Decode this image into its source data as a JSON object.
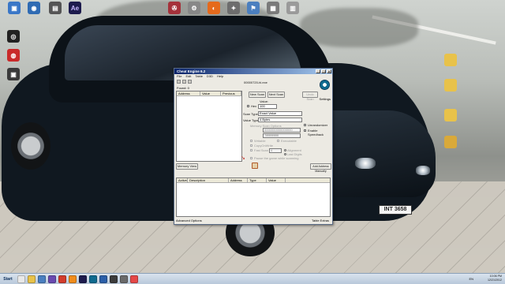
{
  "window": {
    "title": "Cheat Engine 6.2",
    "menu": [
      "File",
      "Edit",
      "Table",
      "D3D",
      "Help"
    ],
    "process": "00000720-hl.exe",
    "found": "Found: 0",
    "settings": "Settings",
    "results_columns": [
      "Address",
      "Value",
      "Previous"
    ],
    "buttons": {
      "new_scan": "New Scan",
      "next_scan": "Next Scan",
      "undo_scan": "Undo Scan",
      "memory_view": "Memory View",
      "add_address": "Add Address Manually"
    },
    "value_label": "Value:",
    "hex_label": "Hex",
    "value_input": "100",
    "scan_type_label": "Scan Type",
    "scan_type": "Exact Value",
    "value_type_label": "Value Type",
    "value_type": "4 Bytes",
    "memory_scan_options": "Memory Scan Options",
    "start_addr": "0000000000000000",
    "stop_addr": "7fffffffffffffff",
    "writable": "Writable",
    "executable": "Executable",
    "copy_on_write": "CopyOnWrite",
    "fast_scan": "Fast Scan",
    "alignment": "Alignment",
    "last_digits": "Last Digits",
    "fast_scan_value": "4",
    "pause_game": "Pause the game while scanning",
    "unrandomizer": "Unrandomizer",
    "enable_speedhack": "Enable Speedhack",
    "address_columns": [
      "Active",
      "Description",
      "Address",
      "Type",
      "Value"
    ],
    "advanced_options": "Advanced Options",
    "table_extras": "Table Extras"
  },
  "taskbar": {
    "start": "Start",
    "language": "EN",
    "time": "10:06 PM",
    "date": "12/21/2012"
  },
  "plate": "INT 3658"
}
